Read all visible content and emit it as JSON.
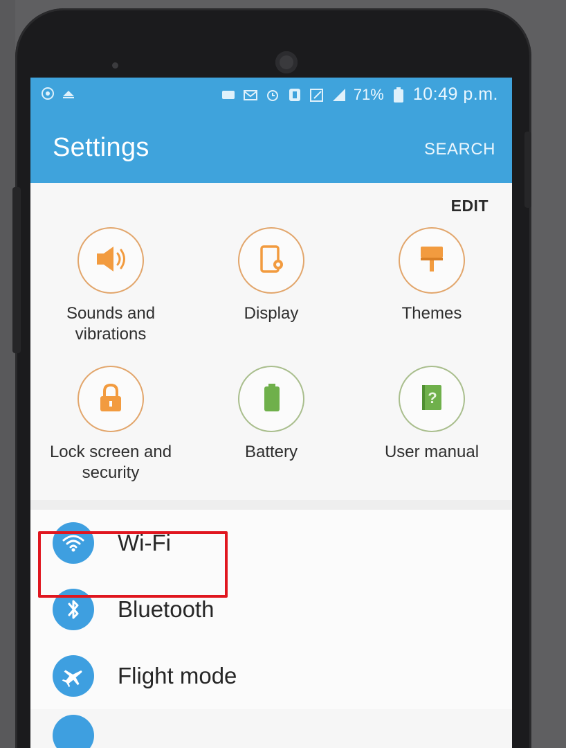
{
  "statusbar": {
    "battery_percent": "71%",
    "time": "10:49 p.m."
  },
  "appbar": {
    "title": "Settings",
    "search_label": "SEARCH"
  },
  "edit_label": "EDIT",
  "quick_settings": [
    {
      "line1": "Sounds and",
      "line2": "vibrations",
      "icon": "speaker-icon"
    },
    {
      "line1": "Display",
      "line2": "",
      "icon": "display-icon"
    },
    {
      "line1": "Themes",
      "line2": "",
      "icon": "paint-roller-icon"
    },
    {
      "line1": "Lock screen and",
      "line2": "security",
      "icon": "lock-icon"
    },
    {
      "line1": "Battery",
      "line2": "",
      "icon": "battery-icon"
    },
    {
      "line1": "User manual",
      "line2": "",
      "icon": "book-icon"
    }
  ],
  "list": [
    {
      "label": "Wi-Fi",
      "icon": "wifi-icon"
    },
    {
      "label": "Bluetooth",
      "icon": "bluetooth-icon"
    },
    {
      "label": "Flight mode",
      "icon": "airplane-icon"
    }
  ],
  "colors": {
    "accent": "#3fa3dc",
    "list_icon": "#3e9fe0",
    "tile_orange": "#f29b3f",
    "tile_green": "#6fb04b",
    "highlight": "#e0161f"
  }
}
